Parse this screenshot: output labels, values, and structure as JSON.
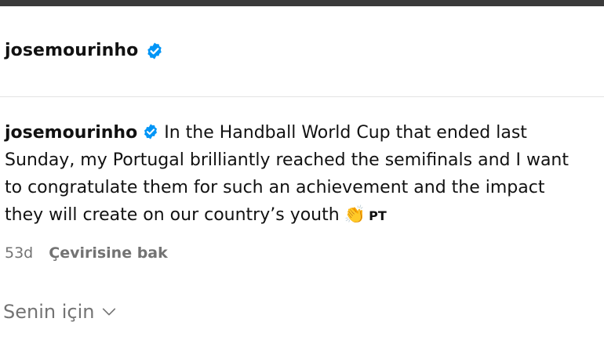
{
  "colors": {
    "verified_badge": "#0095f6",
    "muted_text": "#737373",
    "top_bar": "#3a3a3a"
  },
  "header": {
    "username": "josemourinho",
    "verified_icon": "verified-badge-icon"
  },
  "comment": {
    "username": "josemourinho",
    "verified_icon": "verified-badge-icon",
    "line1": "In the Handball World Cup that ended last",
    "line2": "Sunday, my Portugal brilliantly reached the semifinals and I want",
    "line3": "to congratulate them for such an achievement and the impact",
    "line4": "they will create on our country’s youth",
    "emoji": "👏",
    "lang_tag": "PT"
  },
  "meta": {
    "age": "53d",
    "translate_label": "Çevirisine bak"
  },
  "feed_filter": {
    "label": "Senin için",
    "icon": "chevron-down-icon"
  }
}
